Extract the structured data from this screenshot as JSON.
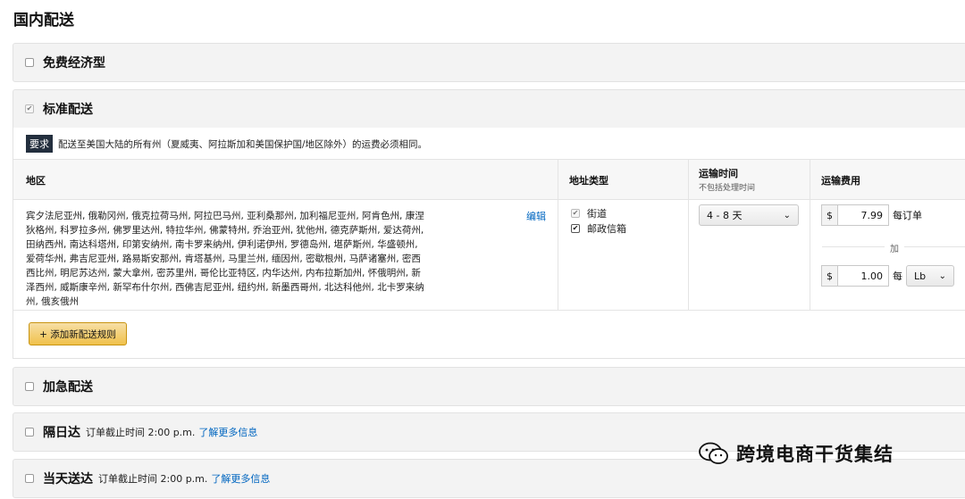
{
  "page_title": "国内配送",
  "sections": {
    "free_economy": {
      "title": "免费经济型"
    },
    "standard": {
      "title": "标准配送"
    },
    "expedited": {
      "title": "加急配送"
    },
    "next_day": {
      "title": "隔日达",
      "note": "订单截止时间 2:00 p.m.",
      "link": "了解更多信息"
    },
    "same_day": {
      "title": "当天送达",
      "note": "订单截止时间 2:00 p.m.",
      "link": "了解更多信息"
    }
  },
  "requirement": {
    "tag": "要求",
    "text": "配送至美国大陆的所有州（夏威夷、阿拉斯加和美国保护国/地区除外）的运费必须相同。"
  },
  "table": {
    "headers": {
      "region": "地区",
      "address_type": "地址类型",
      "transit_time": "运输时间",
      "transit_sub": "不包括处理时间",
      "shipping_fee": "运输费用"
    },
    "region_lines": [
      "宾夕法尼亚州, 俄勒冈州, 俄克拉荷马州, 阿拉巴马州, 亚利桑那州, 加利福尼亚州, 阿肯色州, 康涅",
      "狄格州, 科罗拉多州, 佛罗里达州, 特拉华州, 佛蒙特州, 乔治亚州, 犹他州, 德克萨斯州, 爱达荷州,",
      "田纳西州, 南达科塔州, 印第安纳州, 南卡罗来纳州, 伊利诺伊州, 罗德岛州, 堪萨斯州, 华盛顿州,",
      "爱荷华州, 弗吉尼亚州, 路易斯安那州, 肯塔基州, 马里兰州, 缅因州, 密歇根州, 马萨诸塞州, 密西",
      "西比州, 明尼苏达州, 蒙大拿州, 密苏里州, 哥伦比亚特区, 内华达州, 内布拉斯加州, 怀俄明州, 新",
      "泽西州, 威斯康辛州, 新罕布什尔州, 西佛吉尼亚州, 纽约州, 新墨西哥州, 北达科他州, 北卡罗来纳",
      "州, 俄亥俄州"
    ],
    "edit": "编辑",
    "address_types": [
      "街道",
      "邮政信箱"
    ],
    "transit_value": "4 - 8 天",
    "currency": "$",
    "per_order_amount": "7.99",
    "per_order_label": "每订单",
    "plus_label": "加",
    "per_unit_amount": "1.00",
    "per_unit_label": "每",
    "unit_value": "Lb"
  },
  "add_rule_button": "+ 添加新配送规则",
  "watermark": "跨境电商干货集结"
}
